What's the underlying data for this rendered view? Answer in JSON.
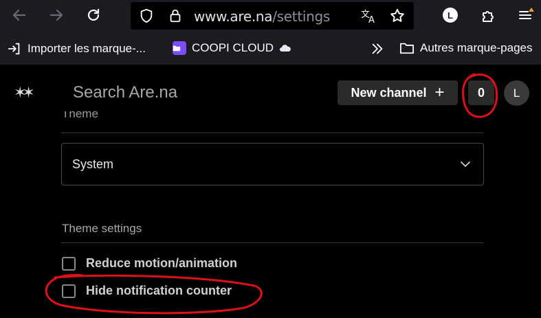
{
  "browser": {
    "url_host": "www.are.na",
    "url_path": "/settings",
    "profile_initial": "L"
  },
  "bookmarks": {
    "import_label": "Importer les marque-...",
    "coopi_label": "COOPI CLOUD",
    "other_label": "Autres marque-pages"
  },
  "header": {
    "logo_text": "✶✶",
    "search_placeholder": "Search Are.na",
    "new_channel_label": "New channel",
    "new_channel_plus": "+",
    "notification_count": "0",
    "avatar_initial": "L"
  },
  "settings": {
    "theme_label": "Theme",
    "theme_value": "System",
    "theme_settings_label": "Theme settings",
    "options": [
      {
        "label": "Reduce motion/animation",
        "checked": false
      },
      {
        "label": "Hide notification counter",
        "checked": false
      }
    ]
  },
  "colors": {
    "annotation": "#e0101a",
    "coopi_accent": "#7c4dff"
  }
}
